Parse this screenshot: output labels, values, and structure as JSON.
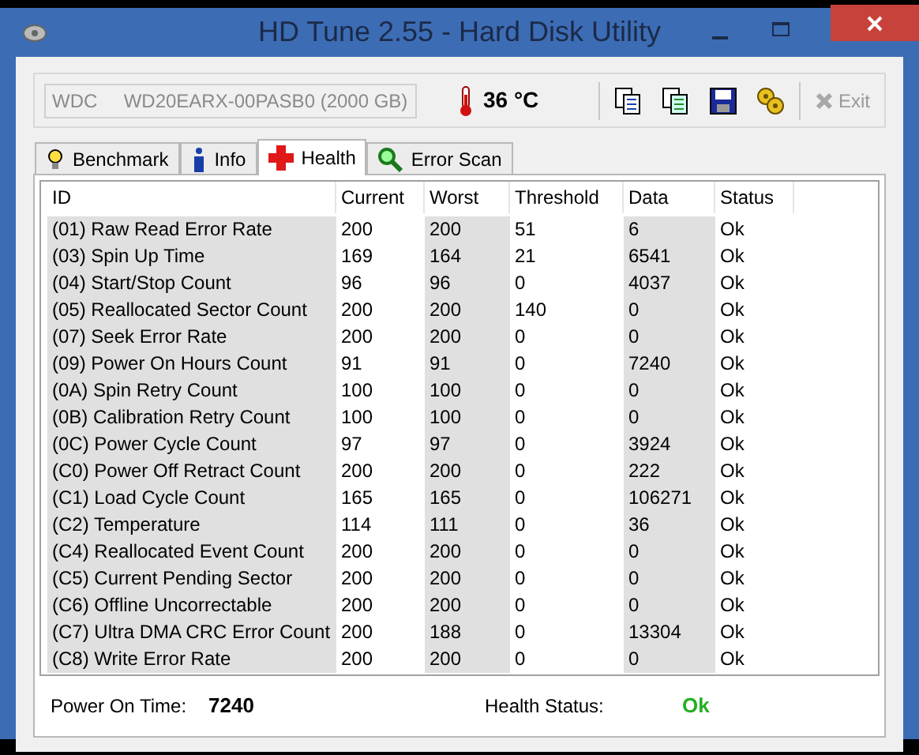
{
  "window": {
    "title": "HD Tune 2.55 - Hard Disk Utility"
  },
  "drive_select": {
    "value": "WDC     WD20EARX-00PASB0 (2000 GB)",
    "disabled": true
  },
  "temperature": "36 °C",
  "toolbar": [
    {
      "kind": "copy"
    },
    {
      "kind": "copy-all"
    },
    {
      "kind": "save"
    },
    {
      "kind": "options"
    }
  ],
  "exit_button": {
    "label": "Exit",
    "disabled": true
  },
  "tabs": [
    {
      "label": "Benchmark",
      "kind": "bulb",
      "selected": false
    },
    {
      "label": "Info",
      "kind": "info",
      "selected": false
    },
    {
      "label": "Health",
      "kind": "cross",
      "selected": true
    },
    {
      "label": "Error Scan",
      "kind": "magnifier",
      "selected": false
    }
  ],
  "table": {
    "columns": [
      "ID",
      "Current",
      "Worst",
      "Threshold",
      "Data",
      "Status"
    ],
    "rows": [
      [
        "(01) Raw Read Error Rate",
        "200",
        "200",
        "51",
        "6",
        "Ok"
      ],
      [
        "(03) Spin Up Time",
        "169",
        "164",
        "21",
        "6541",
        "Ok"
      ],
      [
        "(04) Start/Stop Count",
        "96",
        "96",
        "0",
        "4037",
        "Ok"
      ],
      [
        "(05) Reallocated Sector Count",
        "200",
        "200",
        "140",
        "0",
        "Ok"
      ],
      [
        "(07) Seek Error Rate",
        "200",
        "200",
        "0",
        "0",
        "Ok"
      ],
      [
        "(09) Power On Hours Count",
        "91",
        "91",
        "0",
        "7240",
        "Ok"
      ],
      [
        "(0A) Spin Retry Count",
        "100",
        "100",
        "0",
        "0",
        "Ok"
      ],
      [
        "(0B) Calibration Retry Count",
        "100",
        "100",
        "0",
        "0",
        "Ok"
      ],
      [
        "(0C) Power Cycle Count",
        "97",
        "97",
        "0",
        "3924",
        "Ok"
      ],
      [
        "(C0) Power Off Retract Count",
        "200",
        "200",
        "0",
        "222",
        "Ok"
      ],
      [
        "(C1) Load Cycle Count",
        "165",
        "165",
        "0",
        "106271",
        "Ok"
      ],
      [
        "(C2) Temperature",
        "114",
        "111",
        "0",
        "36",
        "Ok"
      ],
      [
        "(C4) Reallocated Event Count",
        "200",
        "200",
        "0",
        "0",
        "Ok"
      ],
      [
        "(C5) Current Pending Sector",
        "200",
        "200",
        "0",
        "0",
        "Ok"
      ],
      [
        "(C6) Offline Uncorrectable",
        "200",
        "200",
        "0",
        "0",
        "Ok"
      ],
      [
        "(C7) Ultra DMA CRC Error Count",
        "200",
        "188",
        "0",
        "13304",
        "Ok"
      ],
      [
        "(C8) Write Error Rate",
        "200",
        "200",
        "0",
        "0",
        "Ok"
      ]
    ]
  },
  "footer": {
    "power_on_label": "Power On Time:",
    "power_on_value": "7240",
    "health_label": "Health Status:",
    "health_value": "Ok"
  }
}
